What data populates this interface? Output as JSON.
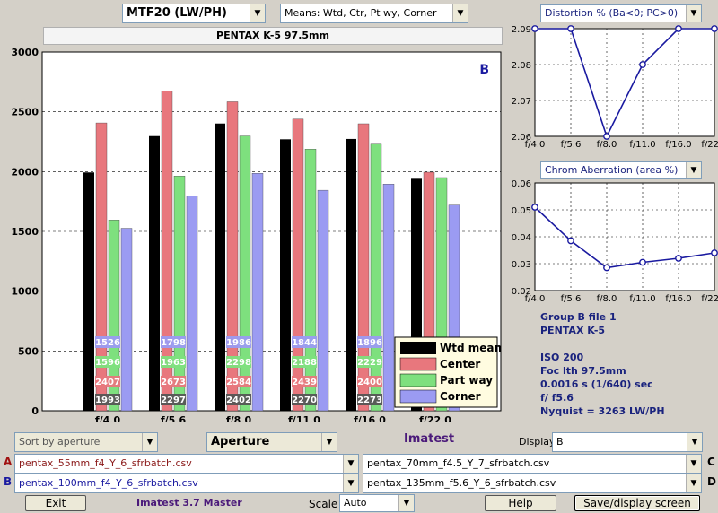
{
  "header": {
    "metric": "MTF20 (LW/PH)",
    "means": "Means: Wtd, Ctr, Pt wy, Corner",
    "camera_title": "PENTAX K-5    97.5mm"
  },
  "main_chart": {
    "group_label": "B",
    "legend": [
      "Wtd mean",
      "Center",
      "Part way",
      "Corner"
    ],
    "colors": {
      "wtd": "#000000",
      "center": "#e8777d",
      "partway": "#7ee07e",
      "corner": "#9b9bf2"
    }
  },
  "chart_data": [
    {
      "type": "bar",
      "categories": [
        "f/4.0",
        "f/5.6",
        "f/8.0",
        "f/11.0",
        "f/16.0",
        "f/22.0"
      ],
      "ylim": [
        0,
        3000
      ],
      "yticks": [
        0,
        500,
        1000,
        1500,
        2000,
        2500,
        3000
      ],
      "series": [
        {
          "name": "Wtd mean",
          "values": [
            1993,
            2297,
            2402,
            2270,
            2273,
            1940
          ]
        },
        {
          "name": "Center",
          "values": [
            2407,
            2673,
            2584,
            2439,
            2400,
            1995
          ]
        },
        {
          "name": "Part way",
          "values": [
            1596,
            1963,
            2298,
            2188,
            2229,
            1950
          ]
        },
        {
          "name": "Corner",
          "values": [
            1526,
            1798,
            1986,
            1844,
            1896,
            1720
          ]
        }
      ],
      "data_labels": {
        "Wtd mean": [
          "1993",
          "2297",
          "2402",
          "2270",
          "2273",
          ""
        ],
        "Center": [
          "2407",
          "2673",
          "2584",
          "2439",
          "2400",
          ""
        ],
        "Part way": [
          "1596",
          "1963",
          "2298",
          "2188",
          "2229",
          ""
        ],
        "Corner": [
          "1526",
          "1798",
          "1986",
          "1844",
          "1896",
          ""
        ]
      }
    },
    {
      "type": "line",
      "title": "Distortion %  (Ba<0; PC>0)",
      "categories": [
        "f/4.0",
        "f/5.6",
        "f/8.0",
        "f/11.0",
        "f/16.0",
        "f/22.0"
      ],
      "values": [
        2.09,
        2.09,
        2.06,
        2.08,
        2.09,
        2.09
      ],
      "ylim": [
        2.06,
        2.09
      ],
      "yticks": [
        "2.06",
        "2.07",
        "2.08",
        "2.09"
      ]
    },
    {
      "type": "line",
      "title": "Chrom Aberration (area %)",
      "categories": [
        "f/4.0",
        "f/5.6",
        "f/8.0",
        "f/11.0",
        "f/16.0",
        "f/22.0"
      ],
      "values": [
        0.051,
        0.0385,
        0.0285,
        0.0305,
        0.032,
        0.034
      ],
      "ylim": [
        0.02,
        0.06
      ],
      "yticks": [
        "0.02",
        "0.03",
        "0.04",
        "0.05",
        "0.06"
      ]
    }
  ],
  "info": {
    "line1": "Group B file 1",
    "line2": "PENTAX K-5",
    "line3": "ISO  200",
    "line4": "Foc lth  97.5mm",
    "line5": "0.0016 s  (1/640)  sec",
    "line6": "f/  f5.6",
    "line7": "Nyquist = 3263 LW/PH"
  },
  "controls": {
    "sort": "Sort by aperture",
    "aperture": "Aperture",
    "imatest": "Imatest",
    "display_label": "Display",
    "display_value": "B",
    "labelA": "A",
    "labelB": "B",
    "labelC": "C",
    "labelD": "D",
    "fileA": "pentax_55mm_f4_Y_6_sfrbatch.csv",
    "fileB": "pentax_100mm_f4_Y_6_sfrbatch.csv",
    "fileC": "pentax_70mm_f4.5_Y_7_sfrbatch.csv",
    "fileD": "pentax_135mm_f5.6_Y_6_sfrbatch.csv",
    "exit": "Exit",
    "version": "Imatest 3.7 Master",
    "scale_label": "Scale",
    "scale_value": "Auto",
    "help": "Help",
    "save": "Save/display screen"
  }
}
